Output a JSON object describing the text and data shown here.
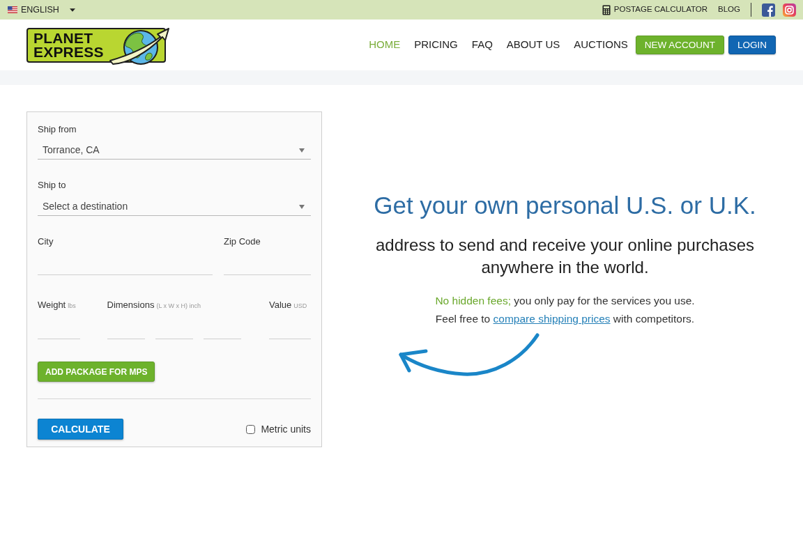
{
  "top_bar": {
    "language": {
      "label": "ENGLISH"
    },
    "links": [
      {
        "label": "POSTAGE CALCULATOR",
        "kind": "calculator"
      },
      {
        "label": "BLOG",
        "kind": "plain"
      }
    ],
    "social": [
      {
        "kind": "facebook"
      },
      {
        "kind": "instagram"
      }
    ]
  },
  "logo": {
    "lines": [
      "PLANET",
      "EXPRESS"
    ]
  },
  "nav": {
    "links": [
      {
        "label": "HOME",
        "selected": true
      },
      {
        "label": "PRICING",
        "selected": false
      },
      {
        "label": "FAQ",
        "selected": false
      },
      {
        "label": "ABOUT US",
        "selected": false
      },
      {
        "label": "AUCTIONS",
        "selected": false
      }
    ],
    "buttons": [
      {
        "label": "NEW ACCOUNT",
        "kind": "success"
      },
      {
        "label": "LOGIN",
        "kind": "primary"
      }
    ]
  },
  "calculator_form": {
    "ship_from": {
      "label": "Ship from",
      "value": "Torrance, CA"
    },
    "ship_to": {
      "label": "Ship to",
      "placeholder": "Select a destination"
    },
    "city": {
      "label": "City"
    },
    "zip_code": {
      "label": "Zip Code"
    },
    "weight": {
      "label": "Weight",
      "unit": "lbs"
    },
    "dimensions": {
      "label": "Dimensions",
      "unit": "(L x W x H) inch"
    },
    "value": {
      "label": "Value",
      "unit": "USD"
    },
    "add_package_button": "ADD PACKAGE FOR MPS",
    "calculate_button": "CALCULATE",
    "metric_units": {
      "label": "Metric units",
      "checked": false
    }
  },
  "hero": {
    "headline": "Get your own personal U.S. or U.K.",
    "subheadline": "address to send and receive your online purchases anywhere in the world.",
    "note": {
      "highlight": "No hidden fees;",
      "text": "you only pay for the services you use."
    },
    "compare": {
      "before": "Feel free to",
      "link": "compare shipping prices",
      "after": "with competitors."
    }
  }
}
